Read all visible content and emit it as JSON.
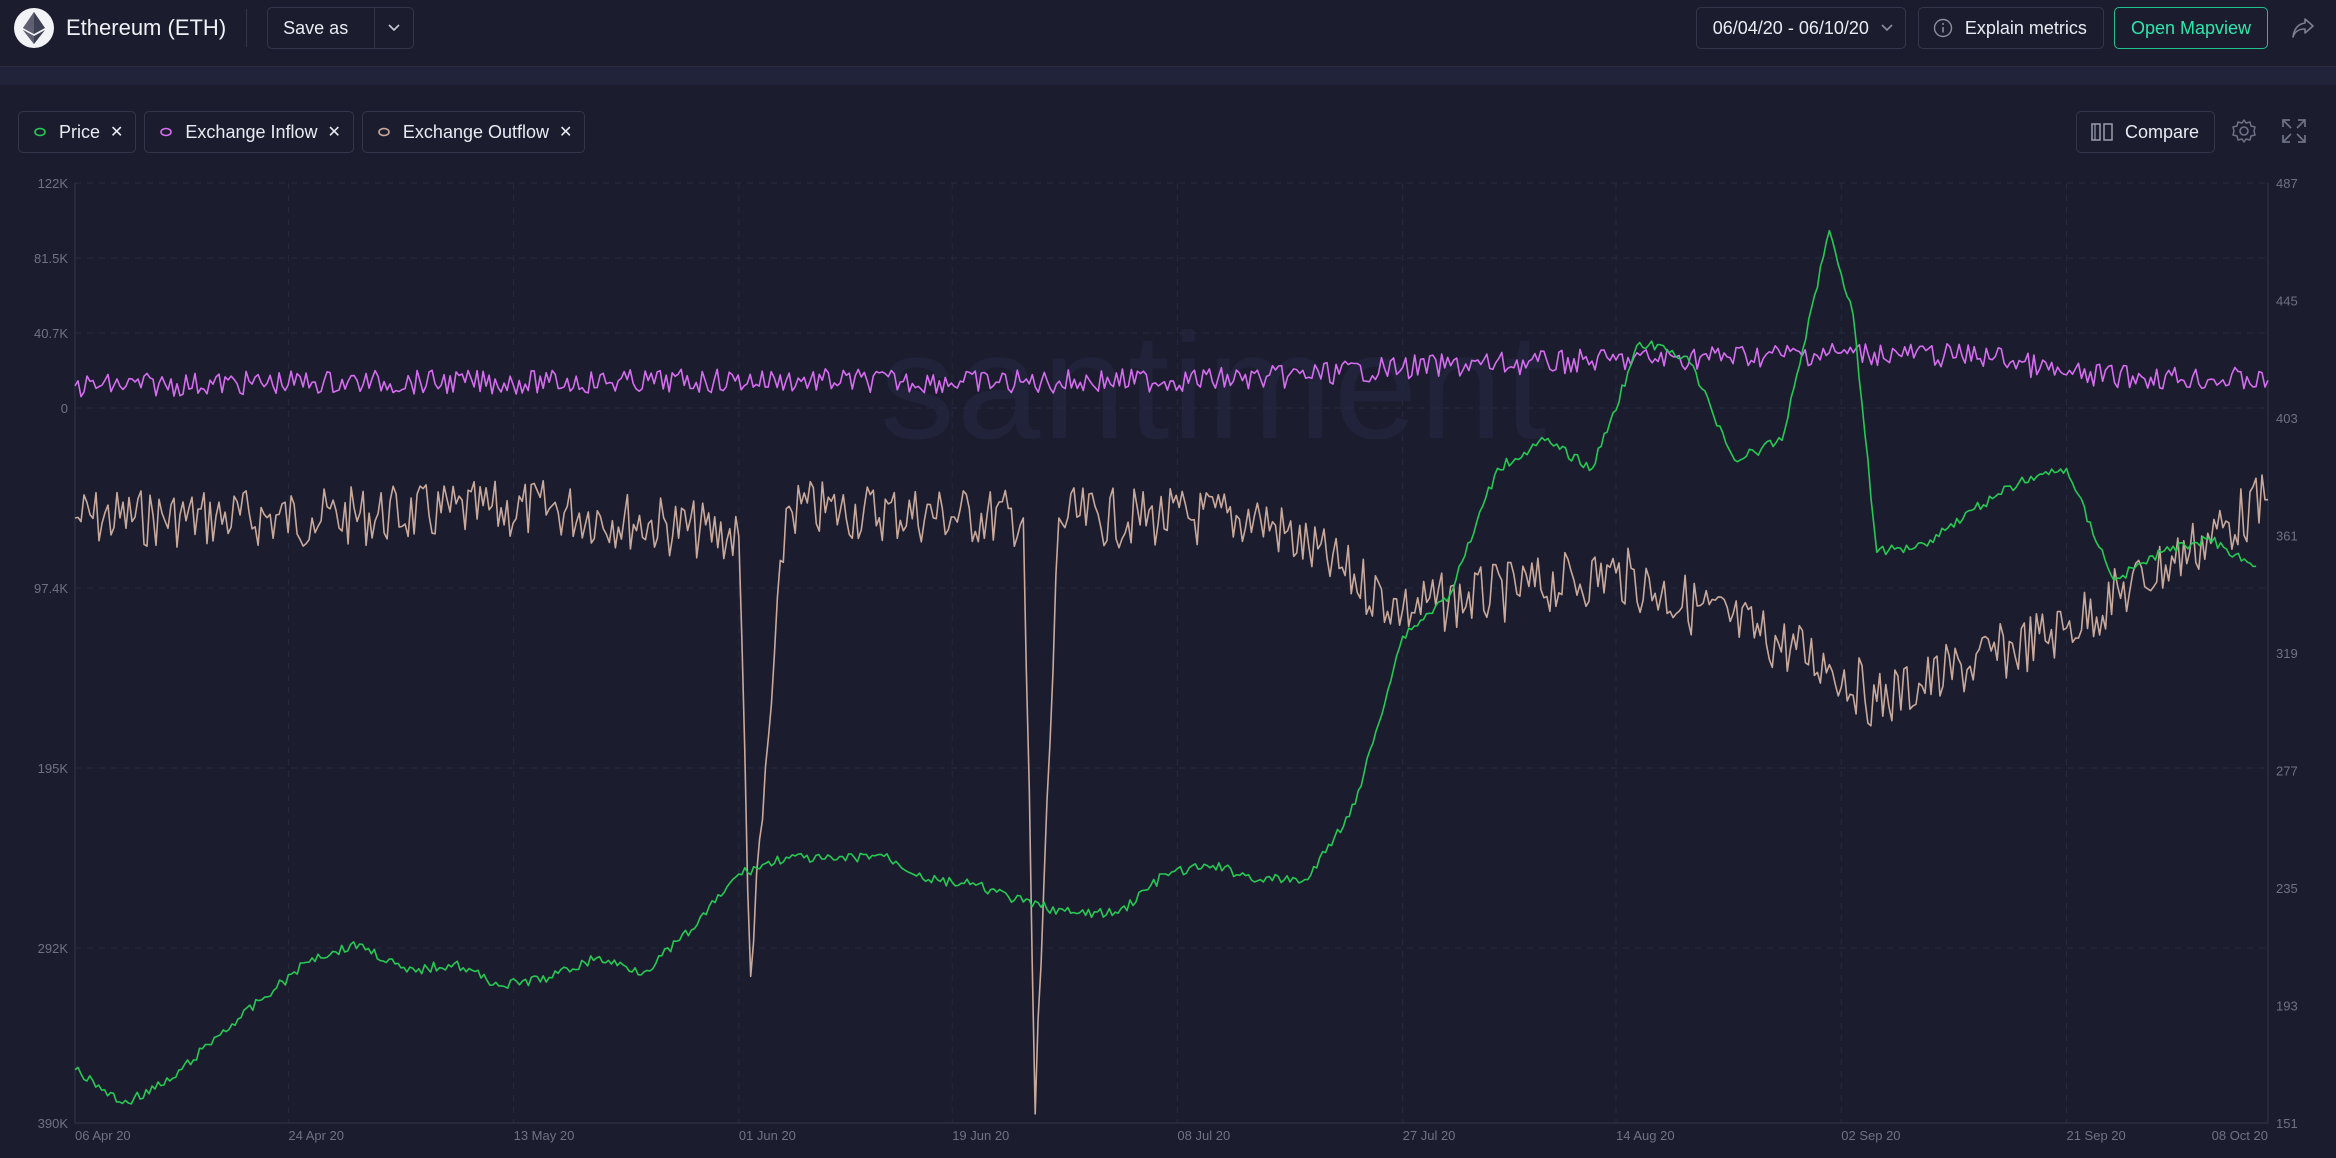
{
  "header": {
    "asset_name": "Ethereum (ETH)",
    "save_as_label": "Save as",
    "date_range": "06/04/20 - 06/10/20",
    "explain_metrics_label": "Explain metrics",
    "open_mapview_label": "Open Mapview"
  },
  "metrics": [
    {
      "label": "Price",
      "color": "#26c953",
      "icon": "series-dot-icon"
    },
    {
      "label": "Exchange Inflow",
      "color": "#d66cf0",
      "icon": "series-dot-icon"
    },
    {
      "label": "Exchange Outflow",
      "color": "#c9a99b",
      "icon": "series-dot-icon"
    }
  ],
  "toolbar": {
    "compare_label": "Compare"
  },
  "watermark": "santiment",
  "chart_data": {
    "type": "line",
    "title": "",
    "x_ticks": [
      "06 Apr 20",
      "24 Apr 20",
      "13 May 20",
      "01 Jun 20",
      "19 Jun 20",
      "08 Jul 20",
      "27 Jul 20",
      "14 Aug 20",
      "02 Sep 20",
      "21 Sep 20",
      "08 Oct 20"
    ],
    "xlim": [
      "06 Apr 20",
      "08 Oct 20"
    ],
    "left_axis": {
      "tick_labels": [
        "122K",
        "81.5K",
        "40.7K",
        "0",
        "97.4K",
        "195K",
        "292K",
        "390K"
      ],
      "inflow_range": [
        0,
        122000
      ],
      "outflow_range": [
        0,
        390000
      ]
    },
    "right_axis": {
      "tick_labels": [
        "487",
        "445",
        "403",
        "361",
        "319",
        "277",
        "235",
        "193",
        "151"
      ],
      "ylim": [
        151,
        487
      ]
    },
    "series": [
      {
        "name": "Price",
        "axis": "right",
        "color": "#26c953",
        "x": [
          "06 Apr 20",
          "10 Apr 20",
          "14 Apr 20",
          "18 Apr 20",
          "22 Apr 20",
          "26 Apr 20",
          "30 Apr 20",
          "04 May 20",
          "08 May 20",
          "12 May 20",
          "16 May 20",
          "20 May 20",
          "24 May 20",
          "28 May 20",
          "01 Jun 20",
          "05 Jun 20",
          "09 Jun 20",
          "13 Jun 20",
          "17 Jun 20",
          "21 Jun 20",
          "25 Jun 20",
          "29 Jun 20",
          "03 Jul 20",
          "07 Jul 20",
          "11 Jul 20",
          "15 Jul 20",
          "19 Jul 20",
          "23 Jul 20",
          "27 Jul 20",
          "31 Jul 20",
          "04 Aug 20",
          "08 Aug 20",
          "12 Aug 20",
          "16 Aug 20",
          "20 Aug 20",
          "24 Aug 20",
          "28 Aug 20",
          "01 Sep 20",
          "03 Sep 20",
          "05 Sep 20",
          "09 Sep 20",
          "13 Sep 20",
          "17 Sep 20",
          "21 Sep 20",
          "25 Sep 20",
          "29 Sep 20",
          "03 Oct 20",
          "07 Oct 20"
        ],
        "values": [
          170,
          158,
          166,
          182,
          196,
          210,
          215,
          205,
          208,
          200,
          203,
          210,
          205,
          220,
          240,
          246,
          245,
          247,
          238,
          236,
          230,
          226,
          226,
          240,
          243,
          238,
          238,
          265,
          325,
          340,
          385,
          395,
          385,
          430,
          425,
          388,
          395,
          470,
          440,
          355,
          358,
          370,
          380,
          385,
          345,
          355,
          360,
          350
        ]
      },
      {
        "name": "Exchange Inflow",
        "axis": "left",
        "color": "#d66cf0",
        "x": [
          "06 Apr 20",
          "26 Apr 20",
          "16 May 20",
          "05 Jun 20",
          "25 Jun 20",
          "15 Jul 20",
          "27 Jul 20",
          "14 Aug 20",
          "02 Sep 20",
          "15 Sep 20",
          "21 Sep 20",
          "08 Oct 20"
        ],
        "values": [
          12000,
          14000,
          14000,
          15000,
          14000,
          16000,
          22000,
          26000,
          30000,
          28000,
          18000,
          15000
        ]
      },
      {
        "name": "Exchange Outflow",
        "axis": "left",
        "color": "#c9a99b",
        "x": [
          "06 Apr 20",
          "26 Apr 20",
          "16 May 20",
          "01 Jun 20",
          "02 Jun 20",
          "05 Jun 20",
          "25 Jun 20",
          "26 Jun 20",
          "28 Jun 20",
          "15 Jul 20",
          "27 Jul 20",
          "14 Aug 20",
          "01 Sep 20",
          "05 Sep 20",
          "21 Sep 20",
          "08 Oct 20"
        ],
        "values": [
          60000,
          60000,
          55000,
          70000,
          310000,
          55000,
          60000,
          385000,
          60000,
          60000,
          110000,
          90000,
          140000,
          160000,
          120000,
          50000
        ]
      }
    ]
  }
}
